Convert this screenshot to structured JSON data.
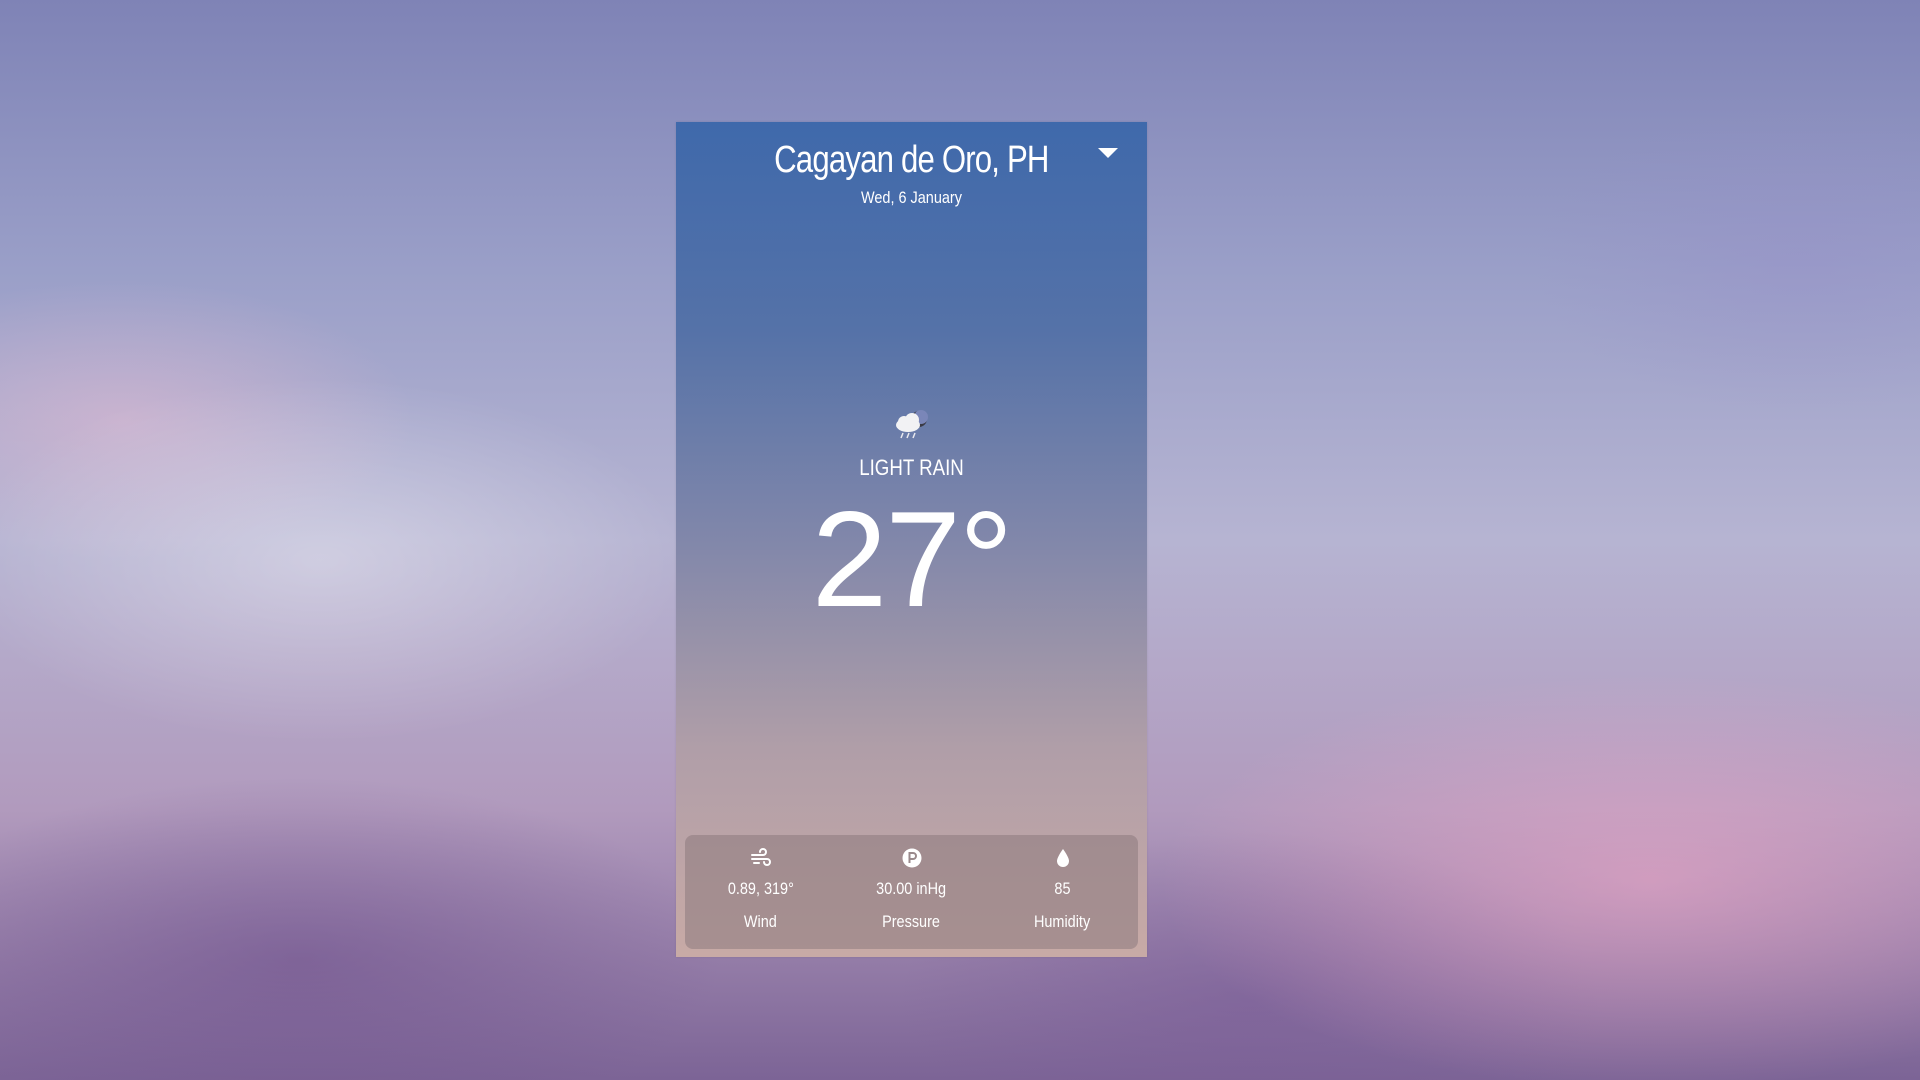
{
  "location": {
    "city": "Cagayan de Oro, PH",
    "date": "Wed, 6 January"
  },
  "weather": {
    "icon": "cloud-rain-night-icon",
    "condition": "LIGHT RAIN",
    "temperature": "27°"
  },
  "stats": [
    {
      "icon": "wind-icon",
      "value": "0.89, 319°",
      "label": "Wind"
    },
    {
      "icon": "pressure-icon",
      "value": "30.00 inHg",
      "label": "Pressure"
    },
    {
      "icon": "humidity-drop-icon",
      "value": "85",
      "label": "Humidity"
    }
  ],
  "dropdown": {
    "icon": "caret-down-icon"
  },
  "colors": {
    "card_top": "#3f69ab",
    "card_bottom": "#c8aaa6",
    "stats_panel": "#8c7a7d",
    "text": "#ffffff"
  }
}
